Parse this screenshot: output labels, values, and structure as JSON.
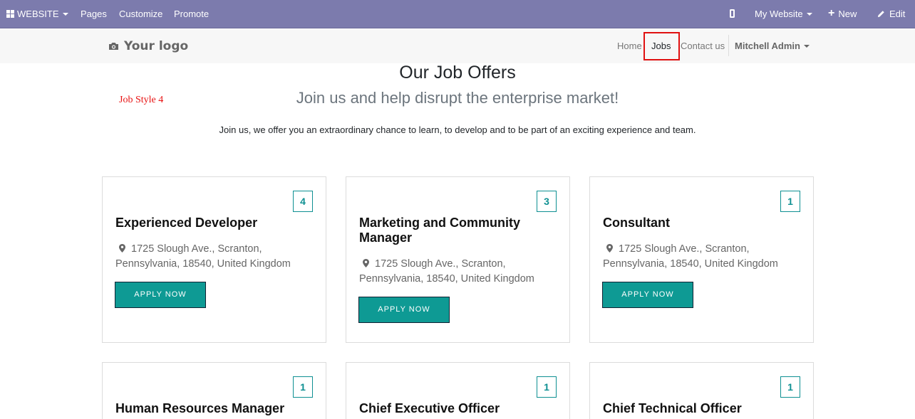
{
  "admin_bar": {
    "website_menu": "WEBSITE",
    "pages": "Pages",
    "customize": "Customize",
    "promote": "Promote",
    "my_website": "My Website",
    "new": "New",
    "edit": "Edit",
    "color": "#7c7bad"
  },
  "navbar": {
    "logo_text": "Your logo",
    "links": {
      "home": "Home",
      "jobs": "Jobs",
      "contact": "Contact us"
    },
    "user": "Mitchell Admin"
  },
  "page": {
    "title": "Our Job Offers",
    "style_tag": "Job Style 4",
    "subtitle": "Join us and help disrupt the enterprise market!",
    "intro": "Join us, we offer you an extraordinary chance to learn, to develop and to be part of an exciting experience and team."
  },
  "jobs": [
    {
      "count": "4",
      "title": "Experienced Developer",
      "location": "1725 Slough Ave., Scranton, Pennsylvania, 18540, United Kingdom",
      "apply": "APPLY NOW"
    },
    {
      "count": "3",
      "title": "Marketing and Community Manager",
      "location": "1725 Slough Ave., Scranton, Pennsylvania, 18540, United Kingdom",
      "apply": "APPLY NOW"
    },
    {
      "count": "1",
      "title": "Consultant",
      "location": "1725 Slough Ave., Scranton, Pennsylvania, 18540, United Kingdom",
      "apply": "APPLY NOW"
    },
    {
      "count": "1",
      "title": "Human Resources Manager"
    },
    {
      "count": "1",
      "title": "Chief Executive Officer"
    },
    {
      "count": "1",
      "title": "Chief Technical Officer"
    }
  ],
  "colors": {
    "accent": "#0e9a94",
    "highlight_box": "#e01010",
    "style_tag": "#e81313"
  }
}
